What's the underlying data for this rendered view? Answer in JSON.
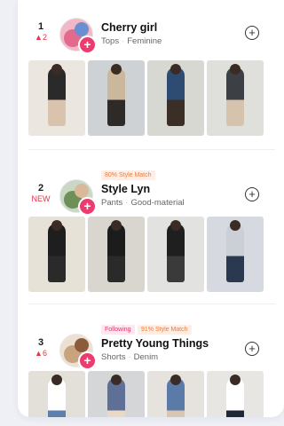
{
  "ranking": [
    {
      "rank": "1",
      "change": "▲2",
      "name": "Cherry girl",
      "tag1": "Tops",
      "tag2": "Feminine",
      "badges": [],
      "avatar_colors": [
        "#e36a8c",
        "#f2b8c8",
        "#6a8fd0"
      ],
      "photo_colors": [
        [
          "#ebe6df",
          "#2b2a2b",
          "#d9c3ad"
        ],
        [
          "#cfd2d4",
          "#cbb79c",
          "#2d2a28"
        ],
        [
          "#d7d8d2",
          "#2e4c72",
          "#3a2e27"
        ],
        [
          "#dfe0dc",
          "#3c3f44",
          "#d6c3ae"
        ]
      ]
    },
    {
      "rank": "2",
      "change": "NEW",
      "name": "Style Lyn",
      "tag1": "Pants",
      "tag2": "Good-material",
      "badges": [
        {
          "label": "80% Style Match",
          "kind": "match"
        }
      ],
      "avatar_colors": [
        "#6e8f58",
        "#c9d7c5",
        "#d9b99a"
      ],
      "photo_colors": [
        [
          "#e7e2d8",
          "#1e1e1e",
          "#2a2a2a"
        ],
        [
          "#d9d6d0",
          "#1c1c1c",
          "#2a2a2a"
        ],
        [
          "#e2e2e0",
          "#1f1f1f",
          "#3a3a3a"
        ],
        [
          "#d6d9e0",
          "#cbd0d6",
          "#2b3950"
        ]
      ]
    },
    {
      "rank": "3",
      "change": "▲6",
      "name": "Pretty Young Things",
      "tag1": "Shorts",
      "tag2": "Denim",
      "badges": [
        {
          "label": "Following",
          "kind": "following"
        },
        {
          "label": "91% Style Match",
          "kind": "match"
        }
      ],
      "avatar_colors": [
        "#c7a47e",
        "#ede0d1",
        "#8b5b3c"
      ],
      "photo_colors": [
        [
          "#e3e0da",
          "#ffffff",
          "#5d7fae"
        ],
        [
          "#d5d6d8",
          "#5e7096",
          "#ead9c6"
        ],
        [
          "#e6e3de",
          "#5a7aa8",
          "#d8c7b0"
        ],
        [
          "#e7e6e3",
          "#ffffff",
          "#1f2636"
        ]
      ]
    }
  ],
  "colors": {
    "accent": "#ec3b6f",
    "rank_up": "#e8334a",
    "match_text": "#f07a3e",
    "following_text": "#e3336a"
  },
  "icons": {
    "plus_badge": "plus-icon",
    "follow": "add-circle-icon"
  }
}
